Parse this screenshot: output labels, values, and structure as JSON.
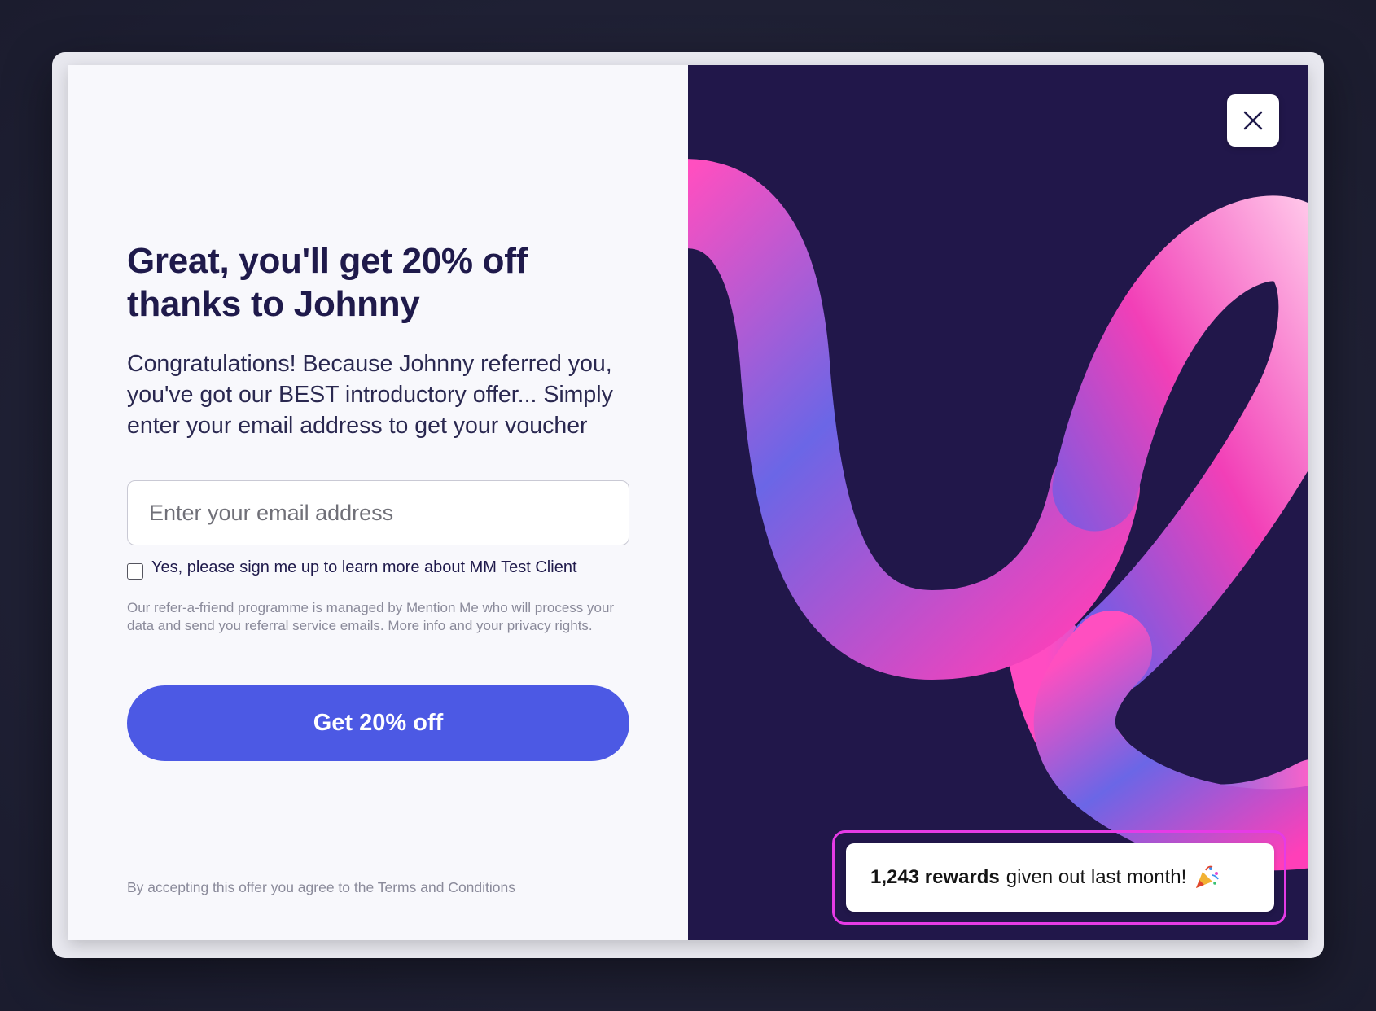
{
  "offer": {
    "headline": "Great, you'll get 20% off thanks to Johnny",
    "intro": "Congratulations! Because Johnny referred you, you've got our BEST introductory offer... Simply enter your email address to get your voucher",
    "email_placeholder": "Enter your email address",
    "email_value": "",
    "consent_label": "Yes, please sign me up to learn more about MM Test Client",
    "consent_checked": false,
    "privacy_text": "Our refer-a-friend programme is managed by Mention Me who will process your data and send you referral service emails. More info and your privacy rights.",
    "cta_label": "Get 20% off",
    "terms_text": "By accepting this offer you agree to the Terms and Conditions"
  },
  "visual": {
    "close_icon": "close-icon",
    "rewards_count": "1,243 rewards",
    "rewards_text": "given out last month!",
    "rewards_icon": "party-popper-icon",
    "highlight_color": "#e53be6",
    "accent_color": "#4c59e4",
    "background_color": "#21174a"
  }
}
